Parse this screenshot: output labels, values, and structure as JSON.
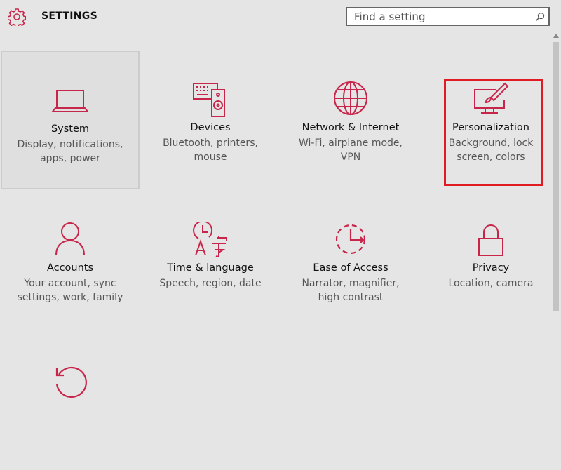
{
  "header": {
    "title": "SETTINGS",
    "search_placeholder": "Find a setting",
    "search_value": ""
  },
  "colors": {
    "accent": "#c8254a",
    "highlight": "#e01b24",
    "background": "#e6e5e5"
  },
  "tiles": [
    {
      "name": "System",
      "desc": "Display, notifications, apps, power",
      "icon": "laptop-icon"
    },
    {
      "name": "Devices",
      "desc": "Bluetooth, printers, mouse",
      "icon": "devices-icon"
    },
    {
      "name": "Network & Internet",
      "desc": "Wi-Fi, airplane mode, VPN",
      "icon": "globe-icon"
    },
    {
      "name": "Personalization",
      "desc": "Background, lock screen, colors",
      "icon": "paintbrush-monitor-icon"
    },
    {
      "name": "Accounts",
      "desc": "Your account, sync settings, work, family",
      "icon": "person-icon"
    },
    {
      "name": "Time & language",
      "desc": "Speech, region, date",
      "icon": "clock-language-icon"
    },
    {
      "name": "Ease of Access",
      "desc": "Narrator, magnifier, high contrast",
      "icon": "ease-of-access-icon"
    },
    {
      "name": "Privacy",
      "desc": "Location, camera",
      "icon": "lock-icon"
    },
    {
      "name": "",
      "desc": "",
      "icon": "update-icon"
    }
  ]
}
